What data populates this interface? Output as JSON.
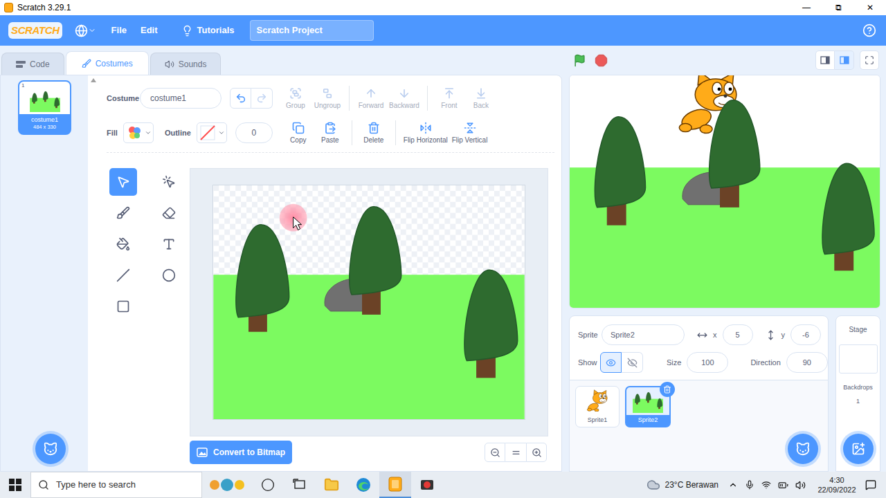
{
  "window": {
    "title": "Scratch 3.29.1",
    "controls": [
      "—",
      "⧉",
      "✕"
    ]
  },
  "menubar": {
    "logo": "SCRATCH",
    "items": [
      "File",
      "Edit"
    ],
    "tutorials": "Tutorials",
    "project_title": "Scratch Project"
  },
  "tabs": [
    {
      "label": "Code",
      "selected": false
    },
    {
      "label": "Costumes",
      "selected": true
    },
    {
      "label": "Sounds",
      "selected": false
    }
  ],
  "costumes": [
    {
      "number": "1",
      "name": "costume1",
      "size": "484 x 330",
      "selected": true
    }
  ],
  "paint_editor": {
    "costume_label": "Costume",
    "costume_name": "costume1",
    "undo_enabled": true,
    "redo_enabled": false,
    "arrange_groups": [
      [
        {
          "label": "Group",
          "disabled": true
        },
        {
          "label": "Ungroup",
          "disabled": true
        }
      ],
      [
        {
          "label": "Forward",
          "disabled": true
        },
        {
          "label": "Backward",
          "disabled": true
        }
      ],
      [
        {
          "label": "Front",
          "disabled": true
        },
        {
          "label": "Back",
          "disabled": true
        }
      ]
    ],
    "fill_label": "Fill",
    "outline_label": "Outline",
    "outline_width": "0",
    "edit_groups": [
      [
        {
          "label": "Copy",
          "disabled": false
        },
        {
          "label": "Paste",
          "disabled": false
        }
      ],
      [
        {
          "label": "Delete",
          "disabled": false
        }
      ],
      [
        {
          "label": "Flip Horizontal",
          "disabled": false
        },
        {
          "label": "Flip Vertical",
          "disabled": false
        }
      ]
    ],
    "tools": [
      {
        "selected": true
      },
      {
        "selected": false
      },
      {
        "selected": false
      },
      {
        "selected": false
      },
      {
        "selected": false
      },
      {
        "selected": false
      },
      {
        "selected": false
      },
      {
        "selected": false
      },
      {
        "selected": false
      }
    ],
    "convert_button": "Convert to Bitmap"
  },
  "sprite_info": {
    "sprite_label": "Sprite",
    "name": "Sprite2",
    "x_label": "x",
    "x": "5",
    "y_label": "y",
    "y": "-6",
    "show_label": "Show",
    "visible": true,
    "size_label": "Size",
    "size": "100",
    "direction_label": "Direction",
    "direction": "90"
  },
  "sprites": [
    {
      "name": "Sprite1",
      "selected": false
    },
    {
      "name": "Sprite2",
      "selected": true
    }
  ],
  "stage_panel": {
    "label": "Stage",
    "backdrops_label": "Backdrops",
    "backdrops": "1"
  },
  "taskbar": {
    "search_placeholder": "Type here to search",
    "weather": "23°C Berawan",
    "time": "4:30",
    "date": "22/09/2022",
    "apps": [
      {
        "selected": false
      },
      {
        "selected": false
      },
      {
        "selected": false
      },
      {
        "selected": false
      },
      {
        "selected": true
      },
      {
        "selected": false
      }
    ]
  }
}
